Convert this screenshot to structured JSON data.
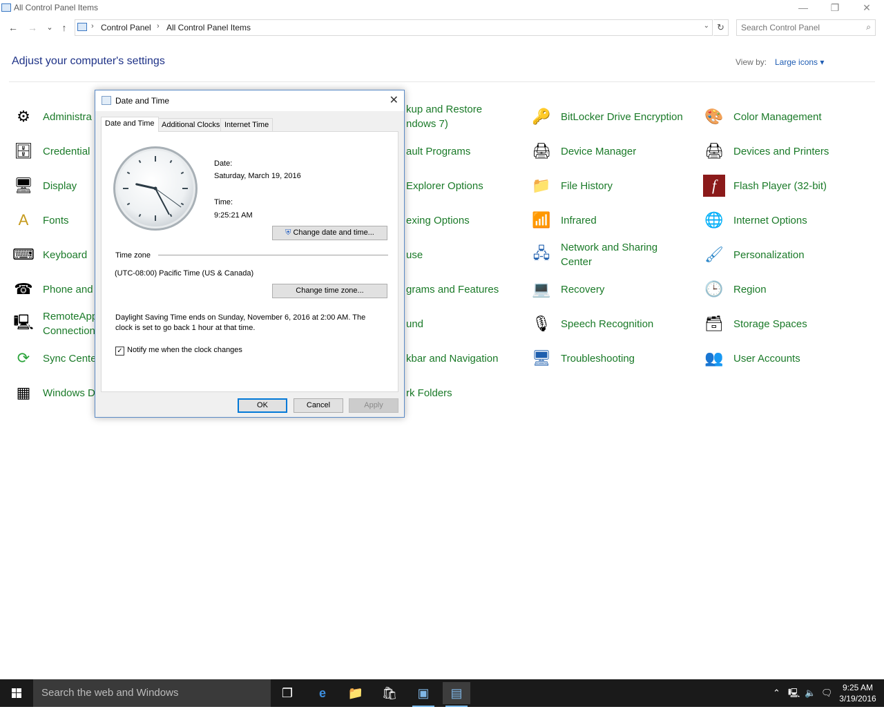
{
  "window": {
    "title": "All Control Panel Items",
    "minimize": "—",
    "restore": "❐",
    "close": "✕"
  },
  "nav": {
    "back": "←",
    "forward": "→",
    "recent": "⌄",
    "up": "↑"
  },
  "address": {
    "crumbs": [
      "Control Panel",
      "All Control Panel Items"
    ],
    "separator": "›"
  },
  "search": {
    "placeholder": "Search Control Panel"
  },
  "header": {
    "title": "Adjust your computer's settings",
    "view_by_label": "View by:",
    "view_by_value": "Large icons ▾"
  },
  "items": {
    "col1": [
      "Administra",
      "Credential",
      "Display",
      "Fonts",
      "Keyboard",
      "Phone and",
      "RemoteApp",
      "Sync Cente",
      "Windows D"
    ],
    "remoteapp_line2": "Connection",
    "col2": [
      "kup and Restore",
      "ault Programs",
      "Explorer Options",
      "exing Options",
      "use",
      "grams and Features",
      "und",
      "kbar and Navigation",
      "rk Folders"
    ],
    "backup_line2": "ndows 7)",
    "col3": [
      "BitLocker Drive Encryption",
      "Device Manager",
      "File History",
      "Infrared",
      "Network and Sharing",
      "Recovery",
      "Speech Recognition",
      "Troubleshooting"
    ],
    "network_line2": "Center",
    "col4": [
      "Color Management",
      "Devices and Printers",
      "Flash Player (32-bit)",
      "Internet Options",
      "Personalization",
      "Region",
      "Storage Spaces",
      "User Accounts"
    ]
  },
  "dialog": {
    "title": "Date and Time",
    "close": "✕",
    "tabs": [
      "Date and Time",
      "Additional Clocks",
      "Internet Time"
    ],
    "date_label": "Date:",
    "date_value": "Saturday, March 19, 2016",
    "time_label": "Time:",
    "time_value": "9:25:21 AM",
    "clock": {
      "hour": 9,
      "minute": 25,
      "second": 21
    },
    "change_datetime": "Change date and time...",
    "timezone_label": "Time zone",
    "timezone_value": "(UTC-08:00) Pacific Time (US & Canada)",
    "change_timezone": "Change time zone...",
    "dst_line1": "Daylight Saving Time ends on Sunday, November 6, 2016 at 2:00 AM. The",
    "dst_line2": "clock is set to go back 1 hour at that time.",
    "notify_checked": "✓",
    "notify_label": "Notify me when the clock changes",
    "ok": "OK",
    "cancel": "Cancel",
    "apply": "Apply"
  },
  "taskbar": {
    "search_placeholder": "Search the web and Windows",
    "time": "9:25 AM",
    "date": "3/19/2016"
  },
  "colors": {
    "link_green": "#1a7a28",
    "heading_blue": "#1e3287",
    "accent": "#0078d7"
  }
}
